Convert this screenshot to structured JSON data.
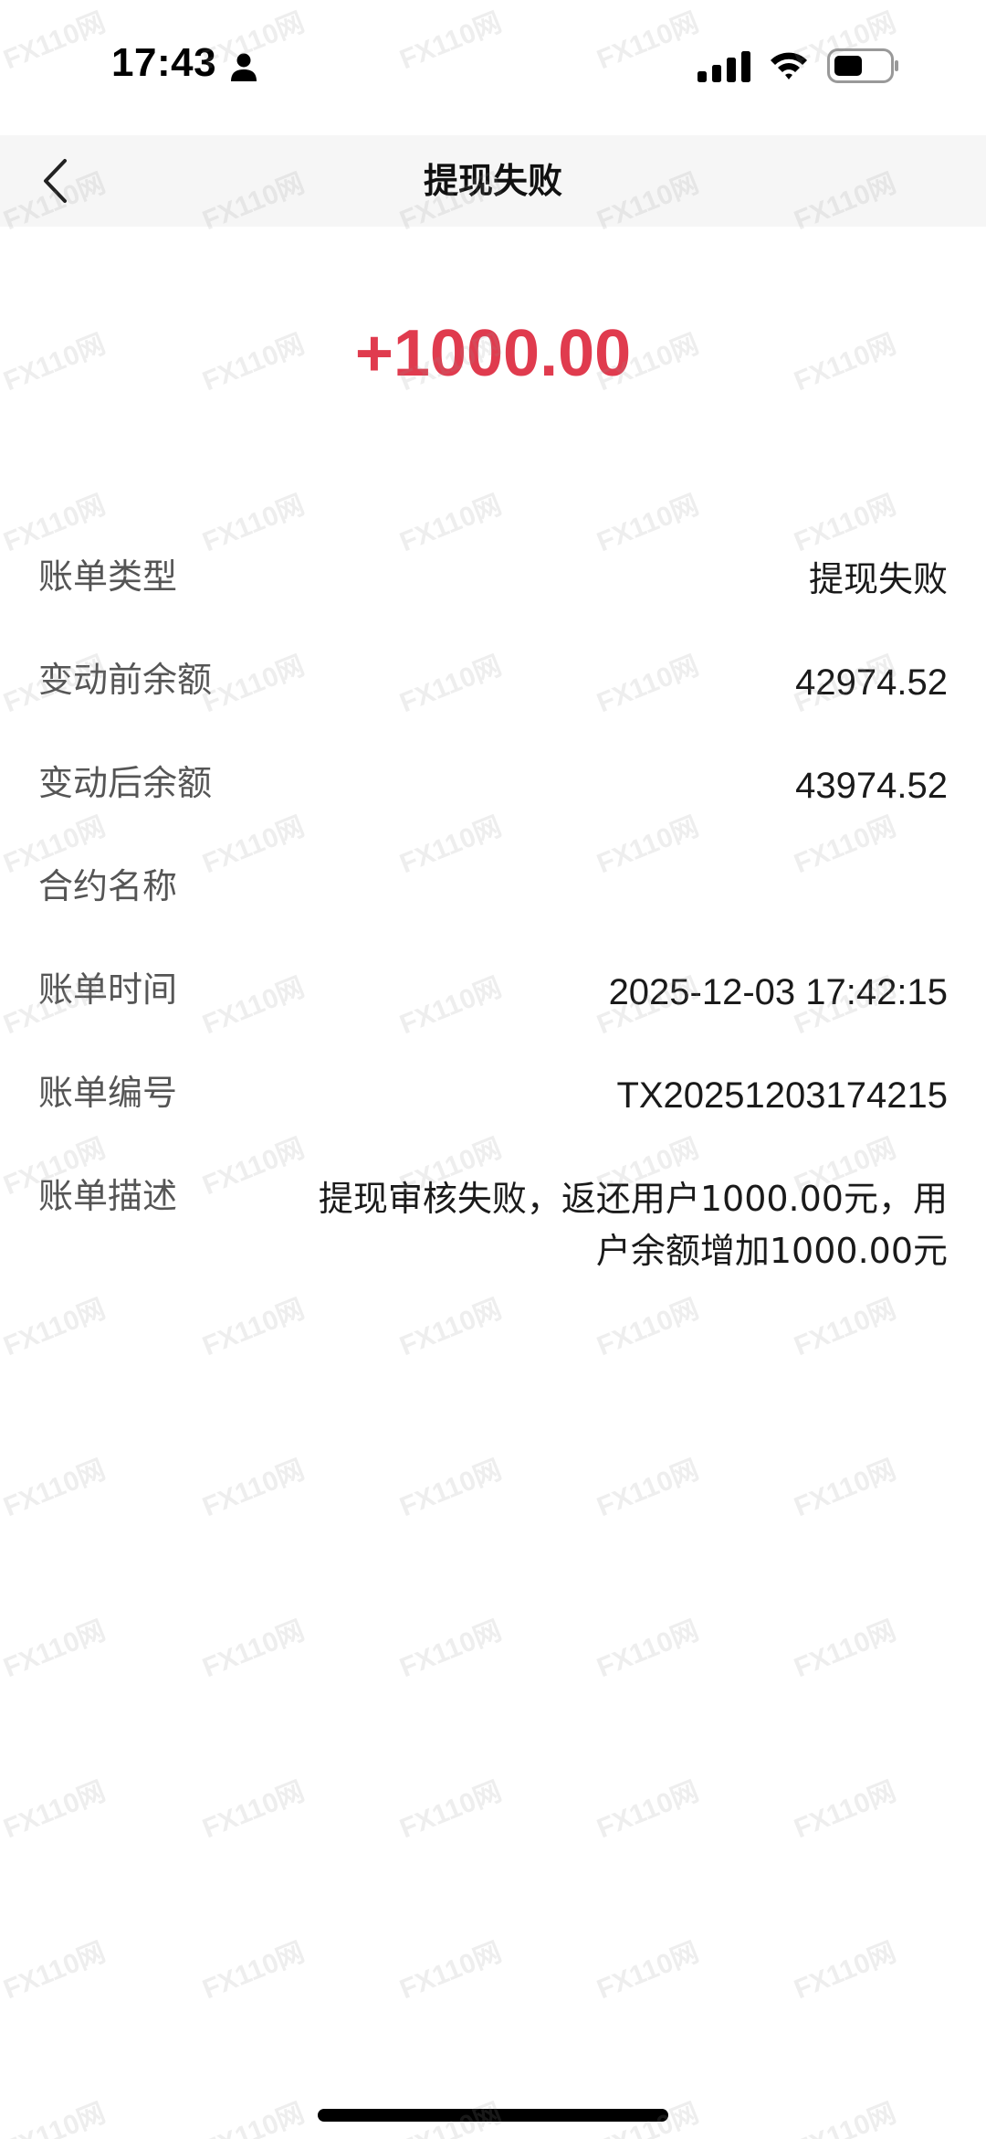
{
  "status_bar": {
    "time": "17:43"
  },
  "nav": {
    "title": "提现失败"
  },
  "amount": "+1000.00",
  "details": [
    {
      "label": "账单类型",
      "value": "提现失败"
    },
    {
      "label": "变动前余额",
      "value": "42974.52"
    },
    {
      "label": "变动后余额",
      "value": "43974.52"
    },
    {
      "label": "合约名称",
      "value": ""
    },
    {
      "label": "账单时间",
      "value": "2025-12-03 17:42:15"
    },
    {
      "label": "账单编号",
      "value": "TX20251203174215"
    },
    {
      "label": "账单描述",
      "value": "提现审核失败，返还用户1000.00元，用户余额增加1000.00元"
    }
  ],
  "watermark": "FX110网",
  "colors": {
    "amount": "#e03b4e",
    "nav_background": "#f6f6f6"
  },
  "icons": {
    "back": "chevron-left-icon",
    "person": "person-icon",
    "signal": "cellular-signal-icon",
    "wifi": "wifi-icon",
    "battery": "battery-icon"
  }
}
